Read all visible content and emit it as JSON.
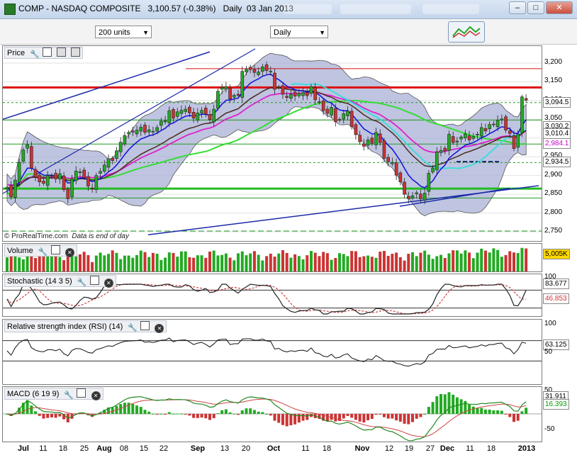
{
  "window": {
    "title": "COMP - NASDAQ COMPOSITE",
    "price_info": "3,100.57 (-0.38%)",
    "period": "Daily",
    "date": "03 Jan 2013"
  },
  "toolbar": {
    "units_select": "200 units",
    "interval_select": "Daily"
  },
  "price_panel": {
    "label": "Price",
    "watermark": "© ProRealTime.com",
    "note": "Data is end of day",
    "axis_ticks": [
      "3,200",
      "3,150",
      "3,100",
      "3,050",
      "3,000",
      "2,950",
      "2,900",
      "2,850",
      "2,800",
      "2,750"
    ],
    "badges": [
      {
        "text": "3,094.5",
        "color": "#000000"
      },
      {
        "text": "3,030.2",
        "color": "#000000"
      },
      {
        "text": "3,010.4",
        "color": "#000000"
      },
      {
        "text": "2,984.1",
        "color": "#cc00cc"
      },
      {
        "text": "2,934.5",
        "color": "#000000"
      }
    ]
  },
  "volume_panel": {
    "label": "Volume",
    "badge": "5,005K"
  },
  "stochastic_panel": {
    "label": "Stochastic (14 3 5)",
    "axis_ticks": [
      "100"
    ],
    "badges": [
      {
        "text": "83.677",
        "color": "#000000"
      },
      {
        "text": "46.853",
        "color": "#cc3333"
      }
    ]
  },
  "rsi_panel": {
    "label": "Relative strength index (RSI) (14)",
    "axis_ticks": [
      "100",
      "50"
    ],
    "badge": "63.125"
  },
  "macd_panel": {
    "label": "MACD (6 19 9)",
    "axis_ticks": [
      "50",
      "-50"
    ],
    "badges": [
      {
        "text": "31.911",
        "color": "#000000"
      },
      {
        "text": "16.393",
        "color": "#009900"
      }
    ]
  },
  "x_axis": [
    {
      "label": "Jul",
      "bold": true
    },
    {
      "label": "11",
      "bold": false
    },
    {
      "label": "18",
      "bold": false
    },
    {
      "label": "25",
      "bold": false
    },
    {
      "label": "Aug",
      "bold": true
    },
    {
      "label": "08",
      "bold": false
    },
    {
      "label": "15",
      "bold": false
    },
    {
      "label": "22",
      "bold": false
    },
    {
      "label": "Sep",
      "bold": true
    },
    {
      "label": "13",
      "bold": false
    },
    {
      "label": "20",
      "bold": false
    },
    {
      "label": "Oct",
      "bold": true
    },
    {
      "label": "11",
      "bold": false
    },
    {
      "label": "18",
      "bold": false
    },
    {
      "label": "Nov",
      "bold": true
    },
    {
      "label": "12",
      "bold": false
    },
    {
      "label": "19",
      "bold": false
    },
    {
      "label": "27",
      "bold": false
    },
    {
      "label": "Dec",
      "bold": true
    },
    {
      "label": "11",
      "bold": false
    },
    {
      "label": "18",
      "bold": false
    },
    {
      "label": "2013",
      "bold": true
    }
  ],
  "colors": {
    "up_candle": "#22aa22",
    "down_candle": "#cc3333",
    "bollinger_fill": "#aab0d6",
    "ma_short": "#1010dd",
    "ma_mid": "#4a2a20",
    "ma_long": "#33dd33",
    "ma_magenta": "#dd22cc",
    "ma_cyan": "#33dddd",
    "resistance": "#dd1111",
    "trendline": "#1a2aaa"
  },
  "chart_data": {
    "type": "candlestick",
    "period": "Daily",
    "ylim": [
      2740,
      3240
    ],
    "closes": [
      2868,
      2843,
      2888,
      2935,
      2968,
      2982,
      2920,
      2896,
      2883,
      2879,
      2900,
      2900,
      2891,
      2905,
      2862,
      2838,
      2890,
      2912,
      2910,
      2894,
      2872,
      2864,
      2900,
      2911,
      2928,
      2945,
      2940,
      2966,
      2989,
      3007,
      3015,
      3016,
      3021,
      3029,
      3015,
      3022,
      3018,
      3028,
      3045,
      3046,
      3073,
      3053,
      3070,
      3074,
      3077,
      3067,
      3053,
      3067,
      3074,
      3064,
      3049,
      3077,
      3125,
      3135,
      3137,
      3104,
      3114,
      3114,
      3178,
      3183,
      3183,
      3175,
      3176,
      3190,
      3180,
      3178,
      3130,
      3136,
      3117,
      3108,
      3117,
      3112,
      3119,
      3121,
      3113,
      3137,
      3102,
      3096,
      3073,
      3066,
      3082,
      3044,
      3049,
      3065,
      3072,
      3030,
      3009,
      2990,
      2978,
      2995,
      2986,
      3015,
      2988,
      2946,
      2937,
      2935,
      2901,
      2883,
      2850,
      2838,
      2846,
      2854,
      2838,
      2853,
      2906,
      2920,
      2963,
      2967,
      2966,
      3010,
      2988,
      2992,
      3003,
      3011,
      2995,
      3004,
      3010,
      3028,
      3019,
      3036,
      3036,
      3048,
      3051,
      3021,
      3012,
      2972,
      3010,
      3110,
      3101
    ],
    "overlays": [
      "Bollinger bands",
      "Moving averages (5)",
      "Support / resistance lines",
      "Trend lines"
    ],
    "volume": {
      "type": "bar",
      "unit": "K",
      "last": "5,005K"
    },
    "stochastic": {
      "type": "line",
      "k": 83.677,
      "d": 46.853,
      "ylim": [
        0,
        100
      ]
    },
    "rsi": {
      "type": "line",
      "value": 63.125,
      "levels": [
        70,
        50,
        30
      ],
      "ylim": [
        0,
        100
      ]
    },
    "macd": {
      "type": "line+histogram",
      "macd": 31.911,
      "signal": 16.393,
      "ylim": [
        -60,
        60
      ]
    }
  }
}
